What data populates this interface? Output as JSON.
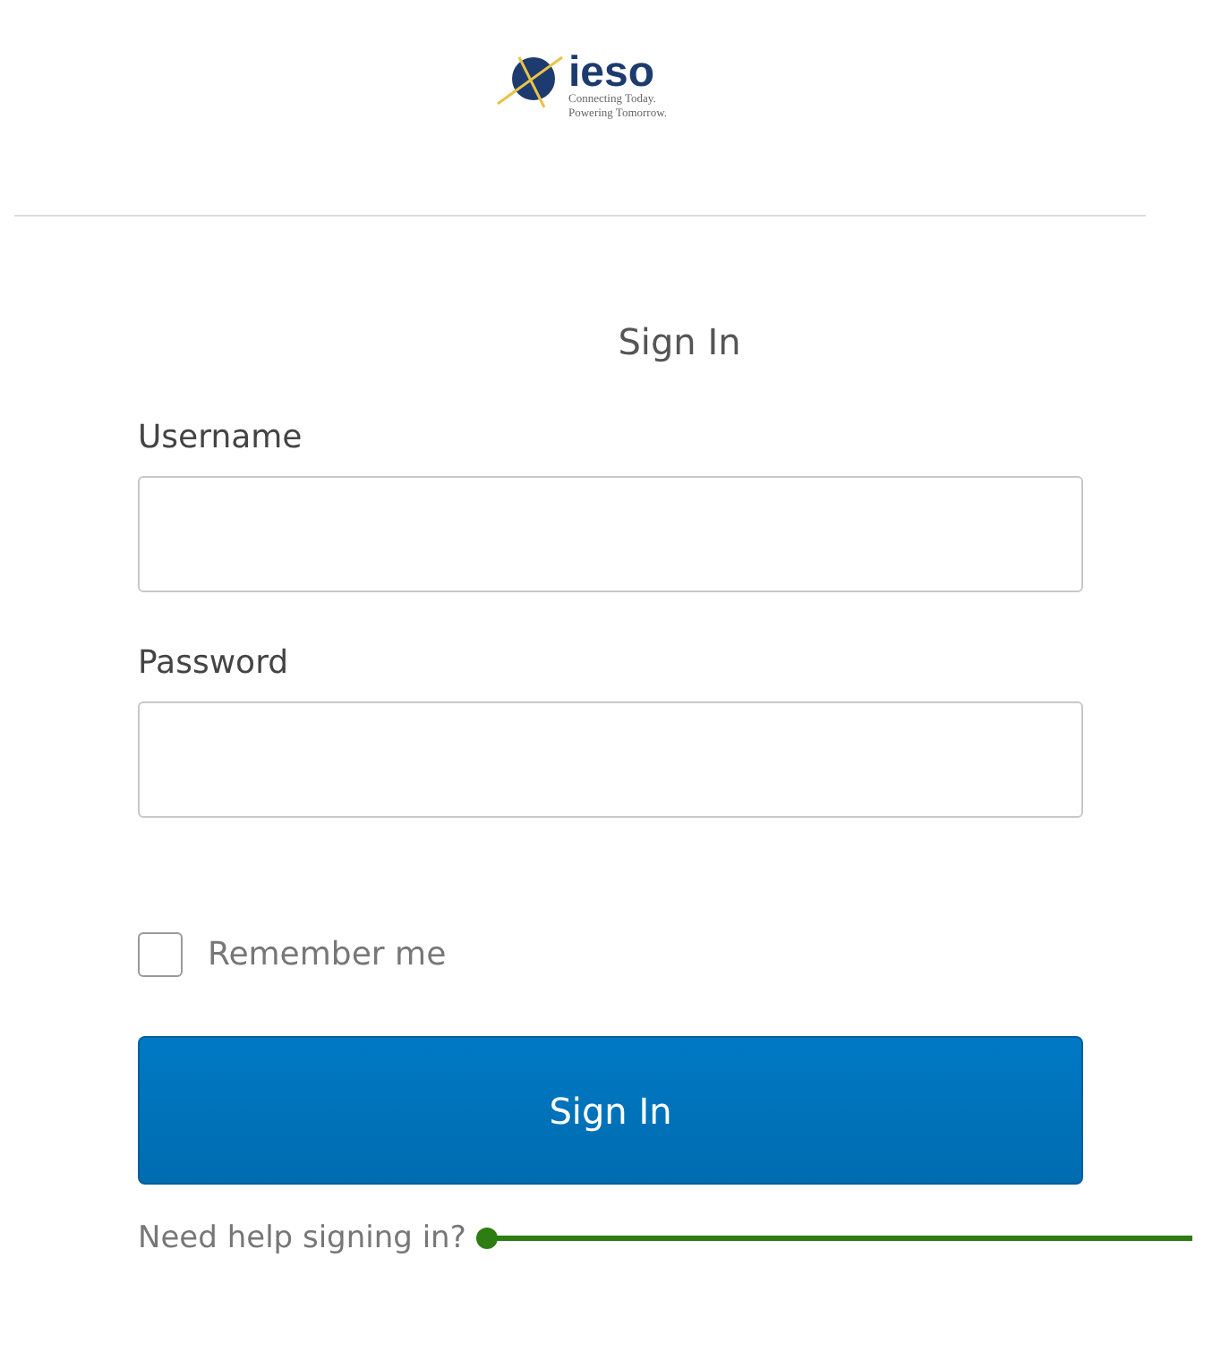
{
  "logo": {
    "name": "ieso",
    "tagline": [
      "Connecting Today.",
      "Powering Tomorrow."
    ]
  },
  "title": "Sign In",
  "fields": [
    {
      "label": "Username"
    },
    {
      "label": "Password"
    }
  ],
  "remember": {
    "label": "Remember me",
    "checked": false
  },
  "button": "Sign In",
  "help_link": "Need help signing in?"
}
